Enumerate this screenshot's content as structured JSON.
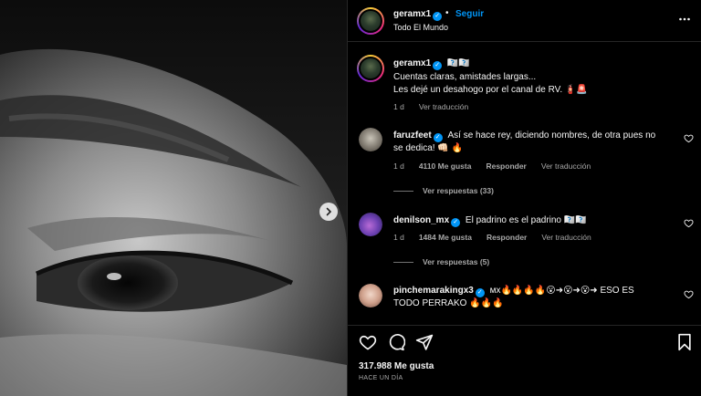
{
  "post": {
    "author": "geramx1",
    "follow_label": "Seguir",
    "location": "Todo El Mundo",
    "more_icon": "more-horizontal-icon"
  },
  "caption": {
    "author": "geramx1",
    "title_emoji": "🇦🇦🇦🇦",
    "line1": "Cuentas claras, amistades largas...",
    "line2": "Les dejé un desahogo por el canal de RV. 🧯🚨",
    "time": "1 d",
    "translate": "Ver traducción"
  },
  "comments": [
    {
      "user": "faruzfeet",
      "text_line1": "Así se hace rey, diciendo nombres, de otra pues no",
      "text_line2": "se dedica! 👊🏻 🔥",
      "time": "1 d",
      "likes": "4110 Me gusta",
      "reply": "Responder",
      "translate": "Ver traducción",
      "replies": "Ver respuestas (33)"
    },
    {
      "user": "denilson_mx",
      "text_line1": "El padrino es el padrino 🇦🇦🇦🇦",
      "time": "1 d",
      "likes": "1484 Me gusta",
      "reply": "Responder",
      "translate": "Ver traducción",
      "replies": "Ver respuestas (5)"
    },
    {
      "user": "pinchemarakingx3",
      "text_line1": "ᴍx🔥🔥🔥🔥😮➜😮➜😮➜ ESO ES",
      "text_line2": "TODO PERRAKO 🔥🔥🔥"
    }
  ],
  "actions": {
    "likes": "317.988 Me gusta",
    "ago": "HACE UN DÍA"
  },
  "colors": {
    "accent": "#0095f6",
    "background": "#000000",
    "muted_text": "#a8a8a8",
    "border": "#262626"
  }
}
